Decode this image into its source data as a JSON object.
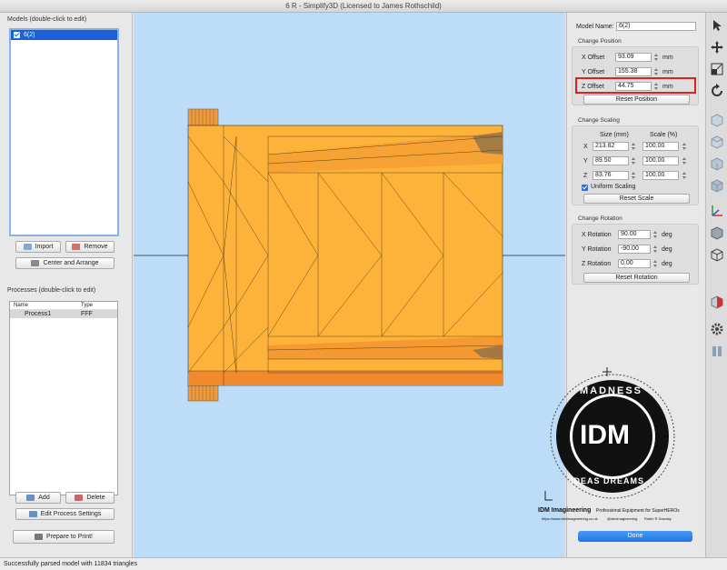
{
  "window": {
    "title": "6 R - Simplify3D (Licensed to James Rothschild)"
  },
  "models": {
    "label": "Models (double-click to edit)",
    "items": [
      {
        "name": "6(2)",
        "checked": true
      }
    ],
    "import_label": "Import",
    "remove_label": "Remove",
    "center_label": "Center and Arrange"
  },
  "processes": {
    "label": "Processes (double-click to edit)",
    "columns": [
      "Name",
      "Type"
    ],
    "rows": [
      {
        "name": "Process1",
        "type": "FFF"
      }
    ],
    "add_label": "Add",
    "delete_label": "Delete",
    "edit_label": "Edit Process Settings",
    "prepare_label": "Prepare to Print!"
  },
  "model_panel": {
    "name_label": "Model Name:",
    "name_value": "6(2)",
    "position": {
      "section": "Change Position",
      "x_label": "X Offset",
      "x_value": "93.09",
      "y_label": "Y Offset",
      "y_value": "155.38",
      "z_label": "Z Offset",
      "z_value": "44.75",
      "unit": "mm",
      "reset_label": "Reset Position"
    },
    "scaling": {
      "section": "Change Scaling",
      "size_header": "Size (mm)",
      "scale_header": "Scale (%)",
      "rows": [
        {
          "axis": "X",
          "size": "213.82",
          "scale": "100.00"
        },
        {
          "axis": "Y",
          "size": "89.50",
          "scale": "100.00"
        },
        {
          "axis": "Z",
          "size": "83.76",
          "scale": "100.00"
        }
      ],
      "uniform_label": "Uniform Scaling",
      "uniform_checked": true,
      "reset_label": "Reset Scale"
    },
    "rotation": {
      "section": "Change Rotation",
      "x_label": "X Rotation",
      "x_value": "90.00",
      "y_label": "Y Rotation",
      "y_value": "-90.00",
      "z_label": "Z Rotation",
      "z_value": "0.00",
      "unit": "deg",
      "reset_label": "Reset Rotation"
    },
    "done_label": "Done"
  },
  "toolbar_icons": [
    "pointer-icon",
    "move-icon",
    "scale-icon",
    "rotate-icon",
    "view-cube-front-icon",
    "view-cube-top-icon",
    "view-cube-side-icon",
    "view-cube-iso-icon",
    "axes-icon",
    "solid-view-icon",
    "wireframe-view-icon",
    "cross-section-icon",
    "settings-gear-icon",
    "build-volume-icon"
  ],
  "status": {
    "text": "Successfully parsed model with 11834 triangles"
  },
  "watermark": {
    "badge": "IDM",
    "ring_top": "MADNESS",
    "ring_bottom": "IDEAS DREAMS",
    "brand": "IDM Imagineering",
    "tagline": "Professional Equipment for SuperHEROs",
    "links": [
      "https://www.idmimagineering.co.uk",
      "@idmimagineering",
      "Robin R Dowsby"
    ]
  },
  "colors": {
    "model_fill": "#fdb33a",
    "model_dark": "#f08a2c",
    "viewport_bg": "#bcdcf7",
    "selection": "#1b60d6",
    "highlight": "#e02020"
  }
}
